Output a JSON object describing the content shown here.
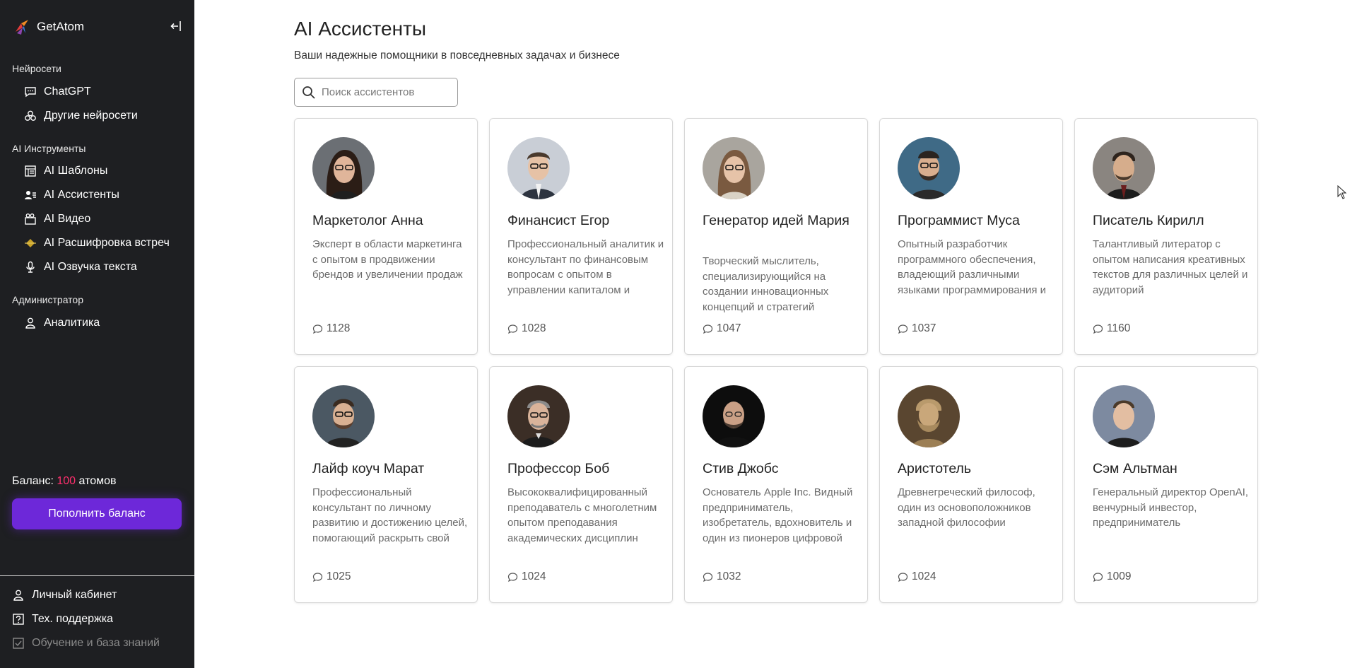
{
  "brand": {
    "name": "GetAtom"
  },
  "sidebar": {
    "sections": [
      {
        "title": "Нейросети",
        "items": [
          {
            "label": "ChatGPT",
            "icon": "chat-icon"
          },
          {
            "label": "Другие нейросети",
            "icon": "cluster-icon"
          }
        ]
      },
      {
        "title": "AI Инструменты",
        "items": [
          {
            "label": "AI Шаблоны",
            "icon": "template-icon"
          },
          {
            "label": "AI Ассистенты",
            "icon": "assistants-icon"
          },
          {
            "label": "AI Видео",
            "icon": "video-icon"
          },
          {
            "label": "AI Расшифровка встреч",
            "icon": "meeting-icon"
          },
          {
            "label": "AI Озвучка текста",
            "icon": "microphone-icon"
          }
        ]
      },
      {
        "title": "Администратор",
        "items": [
          {
            "label": "Аналитика",
            "icon": "user-icon"
          }
        ]
      }
    ],
    "balance_label": "Баланс:",
    "balance_value": "100",
    "balance_unit": "атомов",
    "topup_label": "Пополнить баланс",
    "bottom": [
      {
        "label": "Личный кабинет",
        "icon": "user-icon"
      },
      {
        "label": "Тех. поддержка",
        "icon": "help-icon"
      },
      {
        "label": "Обучение и база знаний",
        "icon": "checkbox-icon"
      }
    ]
  },
  "main": {
    "title": "AI Ассистенты",
    "subtitle": "Ваши надежные помощники в повседневных задачах и бизнесе",
    "search_placeholder": "Поиск ассистентов",
    "cards": [
      {
        "name": "Маркетолог Анна",
        "description": "Эксперт в области маркетинга с опытом в продвижении брендов и увеличении продаж",
        "count": "1128"
      },
      {
        "name": "Финансист Егор",
        "description": "Профессиональный аналитик и консультант по финансовым вопросам с опытом в управлении капиталом и инвестициями",
        "count": "1028"
      },
      {
        "name": "Генератор идей Мария",
        "description": "Творческий мыслитель, специализирующийся на создании инновационных концепций и стратегий",
        "count": "1047"
      },
      {
        "name": "Программист Муса",
        "description": "Опытный разработчик программного обеспечения, владеющий различными языками программирования и технологиями",
        "count": "1037"
      },
      {
        "name": "Писатель Кирилл",
        "description": "Талантливый литератор с опытом написания креативных текстов для различных целей и аудиторий",
        "count": "1160"
      },
      {
        "name": "Лайф коуч Марат",
        "description": "Профессиональный консультант по личному развитию и достижению целей, помогающий раскрыть свой потенциал",
        "count": "1025"
      },
      {
        "name": "Профессор Боб",
        "description": "Высококвалифицированный преподаватель с многолетним опытом преподавания академических дисциплин",
        "count": "1024"
      },
      {
        "name": "Стив Джобс",
        "description": "Основатель Apple Inc. Видный предприниматель, изобретатель, вдохновитель и один из пионеров цифровой эры",
        "count": "1032"
      },
      {
        "name": "Аристотель",
        "description": "Древнегреческий философ, один из основоположников западной философии",
        "count": "1024"
      },
      {
        "name": "Сэм Альтман",
        "description": "Генеральный директор OpenAI, венчурный инвестор, предприниматель",
        "count": "1009"
      }
    ]
  },
  "colors": {
    "sidebar_bg": "#1e1f22",
    "accent": "#6d28d9",
    "balance_highlight": "#ff2f6e"
  }
}
